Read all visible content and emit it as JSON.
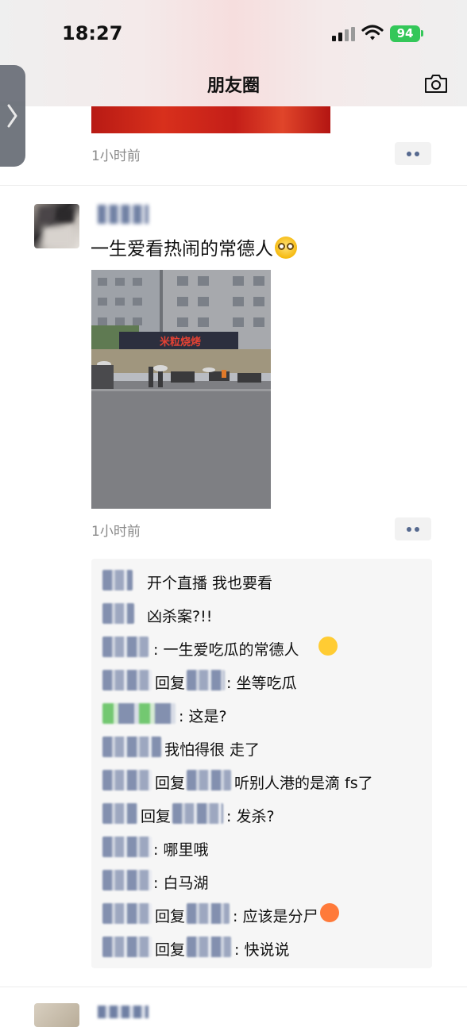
{
  "status_bar": {
    "time": "18:27",
    "battery": "94"
  },
  "header": {
    "title": "朋友圈",
    "camera_icon": "camera-icon",
    "back_icon": "chevron-right-icon"
  },
  "prev_post": {
    "timestamp": "1小时前"
  },
  "post": {
    "username": "",
    "text": "一生爱看热闹的常德人",
    "emoji": "flushed-face",
    "timestamp": "1小时前",
    "photo_sign": "米粒烧烤"
  },
  "comments": [
    {
      "text": "开个直播 我也要看"
    },
    {
      "text": "凶杀案?!!"
    },
    {
      "text": ": 一生爱吃瓜的常德人"
    },
    {
      "text": "回复",
      "text2": ": 坐等吃瓜"
    },
    {
      "text": ": 这是?"
    },
    {
      "text": "我怕得很 走了"
    },
    {
      "text": "回复",
      "text2": "听别人港的是滴 fs了"
    },
    {
      "text": "回复",
      "text2": ": 发杀?"
    },
    {
      "text": ": 哪里哦"
    },
    {
      "text": ": 白马湖"
    },
    {
      "text": "回复",
      "text2": ": 应该是分尸"
    },
    {
      "text": "回复",
      "text2": ": 快说说"
    }
  ],
  "next_post": {
    "username": ""
  },
  "colors": {
    "link_blue": "#576b95",
    "battery_green": "#34c759",
    "timestamp_gray": "#8a8a8a"
  }
}
